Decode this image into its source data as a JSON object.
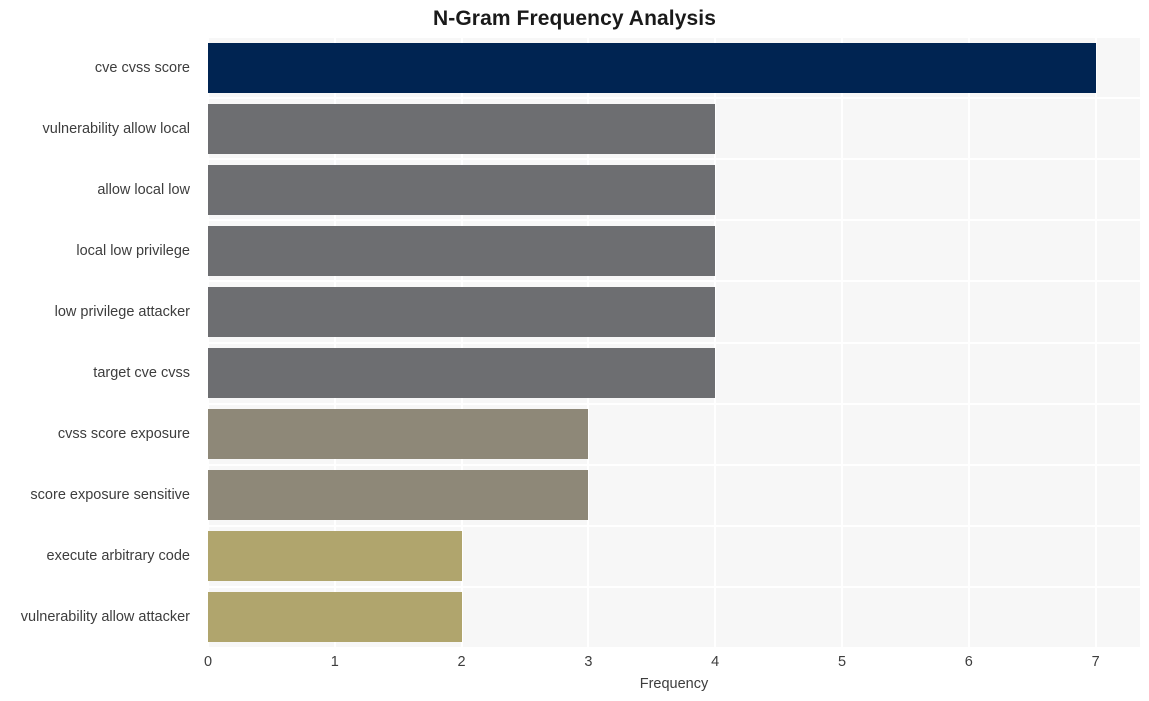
{
  "chart_data": {
    "type": "bar",
    "orientation": "horizontal",
    "title": "N-Gram Frequency Analysis",
    "xlabel": "Frequency",
    "ylabel": "",
    "categories": [
      "cve cvss score",
      "vulnerability allow local",
      "allow local low",
      "local low privilege",
      "low privilege attacker",
      "target cve cvss",
      "cvss score exposure",
      "score exposure sensitive",
      "execute arbitrary code",
      "vulnerability allow attacker"
    ],
    "values": [
      7,
      4,
      4,
      4,
      4,
      4,
      3,
      3,
      2,
      2
    ],
    "bar_colors": [
      "#002452",
      "#6d6e71",
      "#6d6e71",
      "#6d6e71",
      "#6d6e71",
      "#6d6e71",
      "#8e8878",
      "#8e8878",
      "#b0a56d",
      "#b0a56d"
    ],
    "xlim": [
      0,
      7.35
    ],
    "xticks": [
      0,
      1,
      2,
      3,
      4,
      5,
      6,
      7
    ],
    "xtick_labels": [
      "0",
      "1",
      "2",
      "3",
      "4",
      "5",
      "6",
      "7"
    ],
    "grid": true,
    "grid_color": "#ffffff",
    "plot_background": "#f7f7f7",
    "figure_background": "#ffffff",
    "legend": null
  },
  "figure": {
    "title": "N-Gram Frequency Analysis",
    "axis": {
      "x_title": "Frequency"
    }
  }
}
